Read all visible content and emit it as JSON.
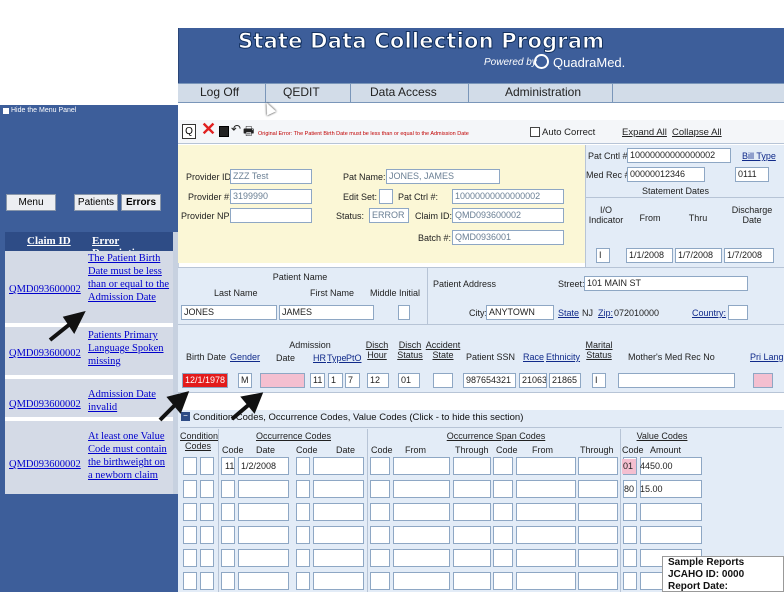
{
  "header": {
    "title": "State Data Collection Program",
    "powered_by": "Powered by",
    "brand": "QuadraMed."
  },
  "nav": [
    "Log Off",
    "QEDIT",
    "Data Access",
    "Administration"
  ],
  "sidebar": {
    "hide_label": "Hide the Menu Panel",
    "tabs": [
      "Menu",
      "Patients",
      "Errors"
    ],
    "table_headers": [
      "Claim ID",
      "Error Description"
    ],
    "rows": [
      {
        "claim_id": "QMD093600002",
        "error": "The Patient Birth Date must be less than or equal to the Admission Date"
      },
      {
        "claim_id": "QMD093600002",
        "error": "Patients Primary Language Spoken missing"
      },
      {
        "claim_id": "QMD093600002",
        "error": "Admission Date invalid"
      },
      {
        "claim_id": "QMD093600002",
        "error": "At least one Value Code must contain the birthweight on a newborn claim"
      }
    ]
  },
  "toolbar": {
    "q_label": "Q",
    "original_error": "Original Error: The Patient Birth Date must be less than or equal to the Admission Date",
    "auto_correct": "Auto Correct",
    "expand_all": "Expand All",
    "collapse_all": "Collapse All"
  },
  "provider": {
    "provider_id_label": "Provider ID:",
    "provider_id": "ZZZ Test",
    "provider_num_label": "Provider #:",
    "provider_num": "3199990",
    "provider_npi_label": "Provider NPI:",
    "pat_name_label": "Pat Name:",
    "pat_name": "JONES, JAMES",
    "edit_set_label": "Edit Set:",
    "pat_ctrl_label": "Pat Ctrl #:",
    "pat_ctrl": "10000000000000002",
    "status_label": "Status:",
    "status": "ERROR",
    "claim_id_label": "Claim ID:",
    "claim_id": "QMD093600002",
    "batch_label": "Batch #:",
    "batch": "QMD0936001"
  },
  "right_panel": {
    "pat_cntl_label": "Pat Cntl #:",
    "pat_cntl": "10000000000000002",
    "med_rec_label": "Med Rec #:",
    "med_rec": "00000012346",
    "bill_type_label": "Bill Type",
    "bill_type": "0111",
    "statement_dates": "Statement Dates",
    "io_label": "I/O Indicator",
    "from_label": "From",
    "thru_label": "Thru",
    "discharge_label": "Discharge Date",
    "io": "I",
    "from": "1/1/2008",
    "thru": "1/7/2008",
    "discharge": "1/7/2008"
  },
  "patient": {
    "name_header": "Patient Name",
    "last_label": "Last Name",
    "first_label": "First Name",
    "mi_label": "Middle Initial",
    "last": "JONES",
    "first": "JAMES",
    "address_label": "Patient Address",
    "street_label": "Street:",
    "street": "101 MAIN ST",
    "city_label": "City:",
    "city": "ANYTOWN",
    "state_label": "State",
    "state": "NJ",
    "zip_label": "Zip:",
    "zip": "072010000",
    "country_label": "Country:"
  },
  "clinical": {
    "birth_label": "Birth Date",
    "gender_label": "Gender",
    "admission_label": "Admission",
    "date_label": "Date",
    "hr_label": "HR",
    "type_label": "Type",
    "ptq_label": "PtO",
    "disch_hour_label": "Disch Hour",
    "disch_status_label": "Disch Status",
    "accident_label": "Accident State",
    "ssn_label": "Patient SSN",
    "race_label": "Race",
    "ethnicity_label": "Ethnicity",
    "marital_label": "Marital Status",
    "mother_label": "Mother's Med Rec No",
    "pri_lang_label": "Pri Lang",
    "birth": "12/1/1978",
    "gender": "M",
    "hr": "11",
    "type": "1",
    "ptq": "7",
    "disch_hour": "12",
    "disch_status": "01",
    "ssn": "987654321",
    "race": "21063",
    "ethnicity": "21865",
    "marital": "I"
  },
  "codes": {
    "section_title": "Condition Codes, Occurrence Codes, Value Codes  (Click - to hide this section)",
    "condition_label": "Condition Codes",
    "occurrence_label": "Occurrence Codes",
    "span_label": "Occurrence Span Codes",
    "value_label": "Value Codes",
    "code_label": "Code",
    "date_label": "Date",
    "from_label": "From",
    "through_label": "Through",
    "amount_label": "Amount",
    "occ_code": "11",
    "occ_date": "1/2/2008",
    "val_codes": [
      {
        "code": "01",
        "amount": "4450.00"
      },
      {
        "code": "80",
        "amount": "15.00"
      }
    ]
  },
  "report": {
    "line1": "Sample Reports",
    "line2": "JCAHO ID: 0000",
    "line3": "Report Date:"
  }
}
